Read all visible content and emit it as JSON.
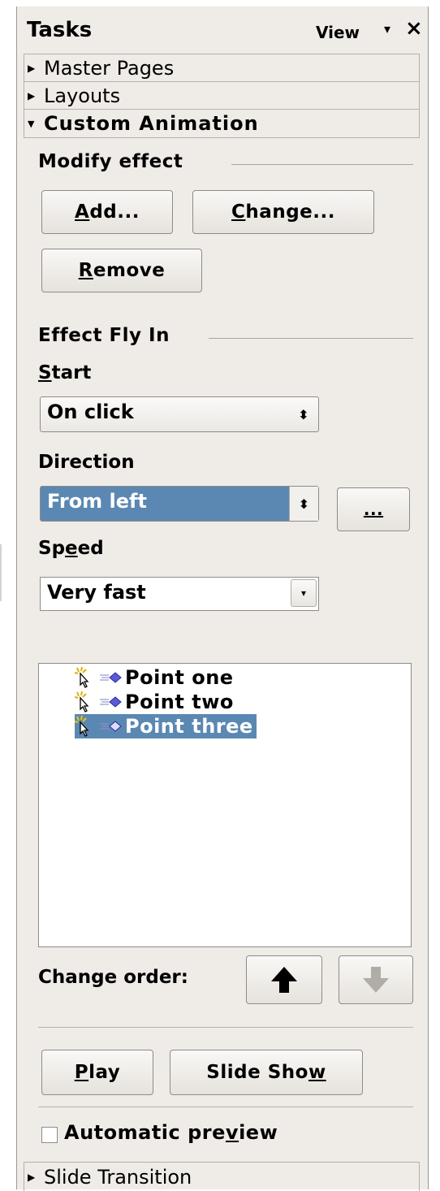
{
  "panel": {
    "title": "Tasks",
    "view_menu": "View",
    "view_arrow": "▾",
    "close": "×"
  },
  "sections": {
    "master_pages": "Master Pages",
    "layouts": "Layouts",
    "custom_animation": "Custom Animation",
    "slide_transition": "Slide Transition",
    "collapsed_marker": "▶",
    "expanded_marker": "▼"
  },
  "modify_effect": {
    "label": "Modify effect",
    "add_prefix": "",
    "add_mnemonic": "A",
    "add_rest": "dd...",
    "change_mnemonic": "C",
    "change_rest": "hange...",
    "remove_mnemonic": "R",
    "remove_rest": "emove"
  },
  "effect": {
    "group_label": "Effect Fly In",
    "start_mnemonic": "S",
    "start_rest": "tart",
    "start_value": "On click",
    "direction_label": "Direction",
    "direction_value": "From left",
    "options_button": "...",
    "speed_prefix": "Sp",
    "speed_mnemonic": "e",
    "speed_rest": "ed",
    "speed_value": "Very fast",
    "combo_arrows": "⬍",
    "dropdown_arrow": "▾"
  },
  "effect_list": {
    "items": [
      {
        "label": "Point one",
        "selected": false
      },
      {
        "label": "Point two",
        "selected": false
      },
      {
        "label": "Point three",
        "selected": true
      }
    ]
  },
  "order": {
    "label": "Change order:",
    "up_icon": "move-up",
    "down_icon": "move-down"
  },
  "playback": {
    "play_mnemonic": "P",
    "play_rest": "lay",
    "slideshow_prefix": "Slide Sho",
    "slideshow_mnemonic": "w",
    "auto_preview_prefix": "Automatic pre",
    "auto_preview_mnemonic": "v",
    "auto_preview_rest": "iew",
    "auto_preview_checked": false
  },
  "colors": {
    "panel_bg": "#efebe7",
    "selection": "#5b88b2"
  }
}
